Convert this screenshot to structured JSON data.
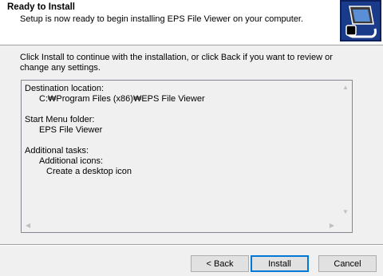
{
  "header": {
    "title": "Ready to Install",
    "subtitle": "Setup is now ready to begin installing EPS File Viewer on your computer.",
    "logo_icon": "computer-install-icon"
  },
  "instruction": "Click Install to continue with the installation, or click Back if you want to review or change any settings.",
  "memo": {
    "destination_label": "Destination location:",
    "destination_value": "C:₩Program Files (x86)₩EPS File Viewer",
    "start_menu_label": "Start Menu folder:",
    "start_menu_value": "EPS File Viewer",
    "tasks_label": "Additional tasks:",
    "icons_label": "Additional icons:",
    "desktop_icon_task": "Create a desktop icon"
  },
  "buttons": {
    "back": "< Back",
    "install": "Install",
    "cancel": "Cancel"
  },
  "colors": {
    "header_bg": "#ffffff",
    "window_bg": "#f0f0f0",
    "default_button_border": "#0078d7"
  }
}
